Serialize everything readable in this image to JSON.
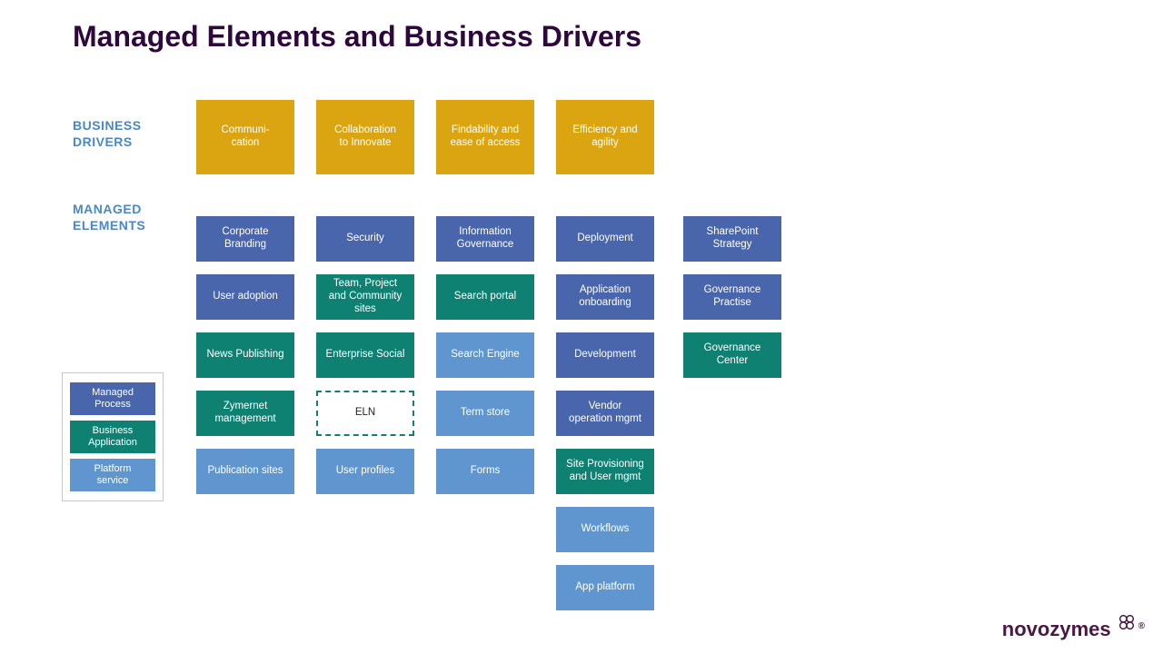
{
  "title": "Managed Elements and Business Drivers",
  "labels": {
    "drivers": "BUSINESS\nDRIVERS",
    "elements": "MANAGED\nELEMENTS"
  },
  "drivers": [
    "Communi-\ncation",
    "Collaboration\nto Innovate",
    "Findability and\nease of access",
    "Efficiency and\nagility"
  ],
  "columns": [
    [
      {
        "t": "Corporate\nBranding",
        "k": "blue"
      },
      {
        "t": "User adoption",
        "k": "blue"
      },
      {
        "t": "News Publishing",
        "k": "teal"
      },
      {
        "t": "Zymernet\nmanagement",
        "k": "teal"
      },
      {
        "t": "Publication sites",
        "k": "light"
      }
    ],
    [
      {
        "t": "Security",
        "k": "blue"
      },
      {
        "t": "Team, Project\nand Community\nsites",
        "k": "teal"
      },
      {
        "t": "Enterprise Social",
        "k": "teal"
      },
      {
        "t": "ELN",
        "k": "eln"
      },
      {
        "t": "User profiles",
        "k": "light"
      }
    ],
    [
      {
        "t": "Information\nGovernance",
        "k": "blue"
      },
      {
        "t": "Search portal",
        "k": "teal"
      },
      {
        "t": "Search Engine",
        "k": "light"
      },
      {
        "t": "Term store",
        "k": "light"
      },
      {
        "t": "Forms",
        "k": "light"
      }
    ],
    [
      {
        "t": "Deployment",
        "k": "blue"
      },
      {
        "t": "Application\nonboarding",
        "k": "blue"
      },
      {
        "t": "Development",
        "k": "blue"
      },
      {
        "t": "Vendor\noperation mgmt",
        "k": "blue"
      },
      {
        "t": "Site Provisioning\nand User mgmt",
        "k": "teal"
      },
      {
        "t": "Workflows",
        "k": "light"
      },
      {
        "t": "App platform",
        "k": "light"
      }
    ],
    [
      {
        "t": "SharePoint\nStrategy",
        "k": "blue"
      },
      {
        "t": "Governance\nPractise",
        "k": "blue"
      },
      {
        "t": "Governance\nCenter",
        "k": "teal"
      }
    ]
  ],
  "legend": [
    {
      "t": "Managed\nProcess",
      "k": "blue"
    },
    {
      "t": "Business\nApplication",
      "k": "teal"
    },
    {
      "t": "Platform\nservice",
      "k": "light"
    }
  ],
  "logo_text": "novozymes"
}
